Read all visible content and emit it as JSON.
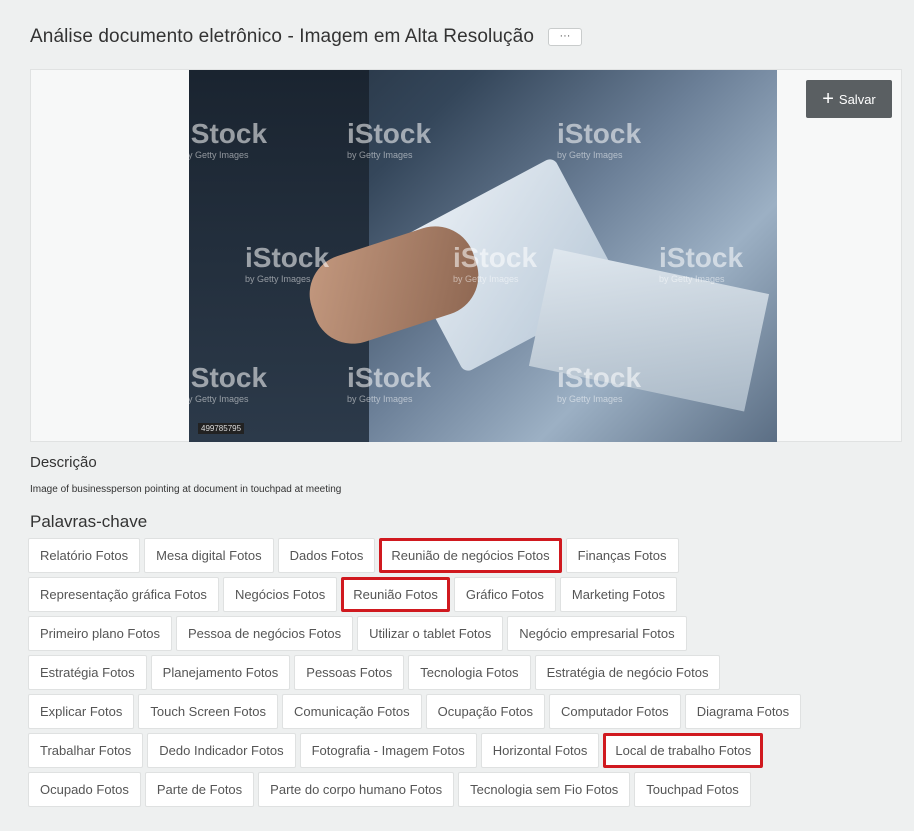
{
  "header": {
    "title": "Análise documento eletrônico - Imagem em Alta Resolução",
    "more_label": "···"
  },
  "image": {
    "save_label": "Salvar",
    "stock_id": "499785795",
    "watermark": "iStock",
    "watermark_sub": "by Getty Images"
  },
  "description": {
    "heading": "Descrição",
    "text": "Image of businessperson pointing at document in touchpad at meeting"
  },
  "keywords": {
    "heading": "Palavras-chave",
    "rows": [
      [
        "Relatório Fotos",
        "Mesa digital Fotos",
        "Dados Fotos",
        "Reunião de negócios Fotos",
        "Finanças Fotos"
      ],
      [
        "Representação gráfica Fotos",
        "Negócios Fotos",
        "Reunião Fotos",
        "Gráfico Fotos",
        "Marketing Fotos"
      ],
      [
        "Primeiro plano Fotos",
        "Pessoa de negócios Fotos",
        "Utilizar o tablet Fotos",
        "Negócio empresarial Fotos"
      ],
      [
        "Estratégia Fotos",
        "Planejamento Fotos",
        "Pessoas Fotos",
        "Tecnologia Fotos",
        "Estratégia de negócio Fotos"
      ],
      [
        "Explicar Fotos",
        "Touch Screen Fotos",
        "Comunicação Fotos",
        "Ocupação Fotos",
        "Computador Fotos",
        "Diagrama Fotos"
      ],
      [
        "Trabalhar Fotos",
        "Dedo Indicador Fotos",
        "Fotografia - Imagem Fotos",
        "Horizontal Fotos",
        "Local de trabalho Fotos"
      ],
      [
        "Ocupado Fotos",
        "Parte de Fotos",
        "Parte do corpo humano Fotos",
        "Tecnologia sem Fio Fotos",
        "Touchpad Fotos"
      ]
    ],
    "highlighted": [
      "Reunião de negócios Fotos",
      "Reunião Fotos",
      "Local de trabalho Fotos"
    ],
    "highlight_color": "#d0191f"
  }
}
